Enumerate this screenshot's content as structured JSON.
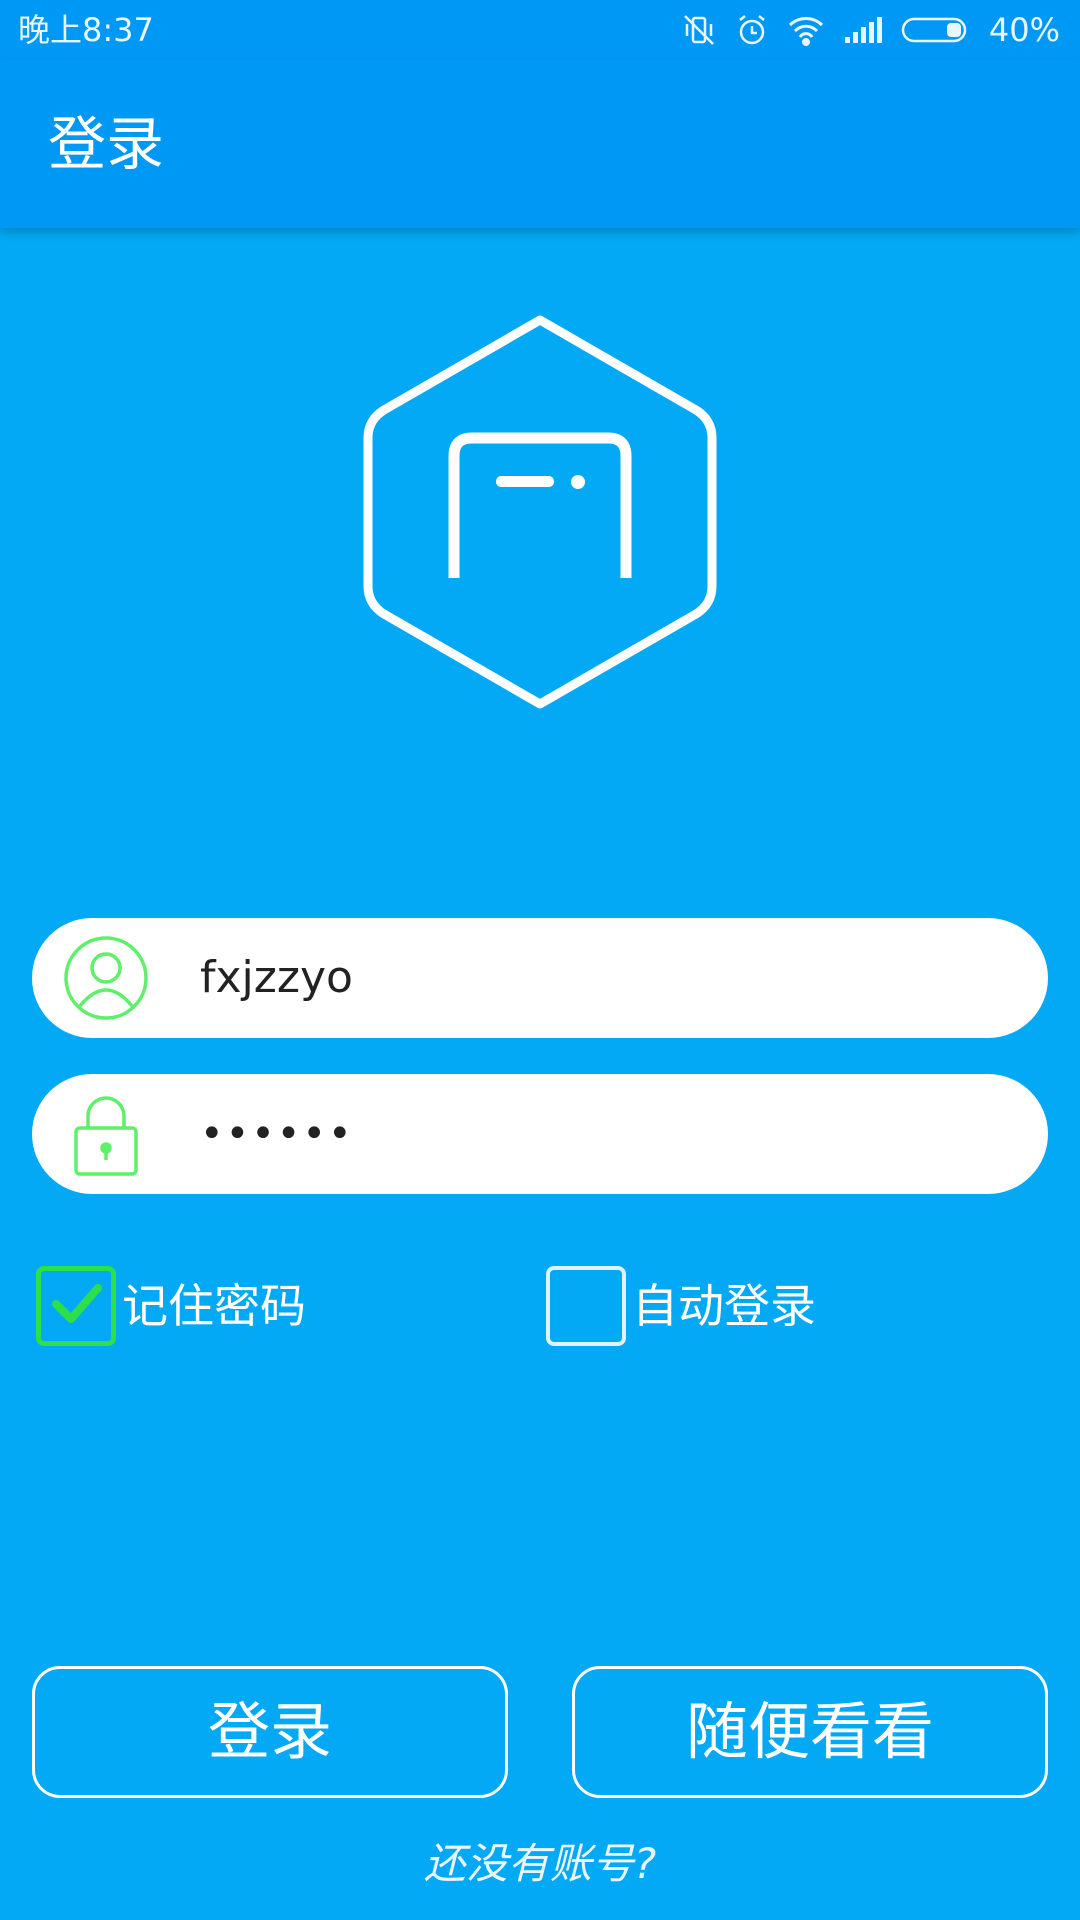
{
  "status_bar": {
    "time": "晚上8:37",
    "battery": "40%",
    "icons": [
      "vibrate-off-icon",
      "alarm-icon",
      "wifi-icon",
      "signal-icon",
      "battery-icon"
    ]
  },
  "app_bar": {
    "title": "登录"
  },
  "logo": {
    "icon": "hexagon-door-logo"
  },
  "form": {
    "username": {
      "value": "fxjzzyo",
      "icon": "user-avatar-icon"
    },
    "password": {
      "value": "••••••",
      "icon": "lock-icon"
    },
    "remember_password": {
      "label": "记住密码",
      "checked": true
    },
    "auto_login": {
      "label": "自动登录",
      "checked": false
    }
  },
  "buttons": {
    "login": "登录",
    "browse": "随便看看"
  },
  "register_link": "还没有账号?",
  "colors": {
    "background": "#03A9F4",
    "app_bar": "#0098F5",
    "icon_green": "#5ff06a",
    "check_green": "#2de04a"
  }
}
